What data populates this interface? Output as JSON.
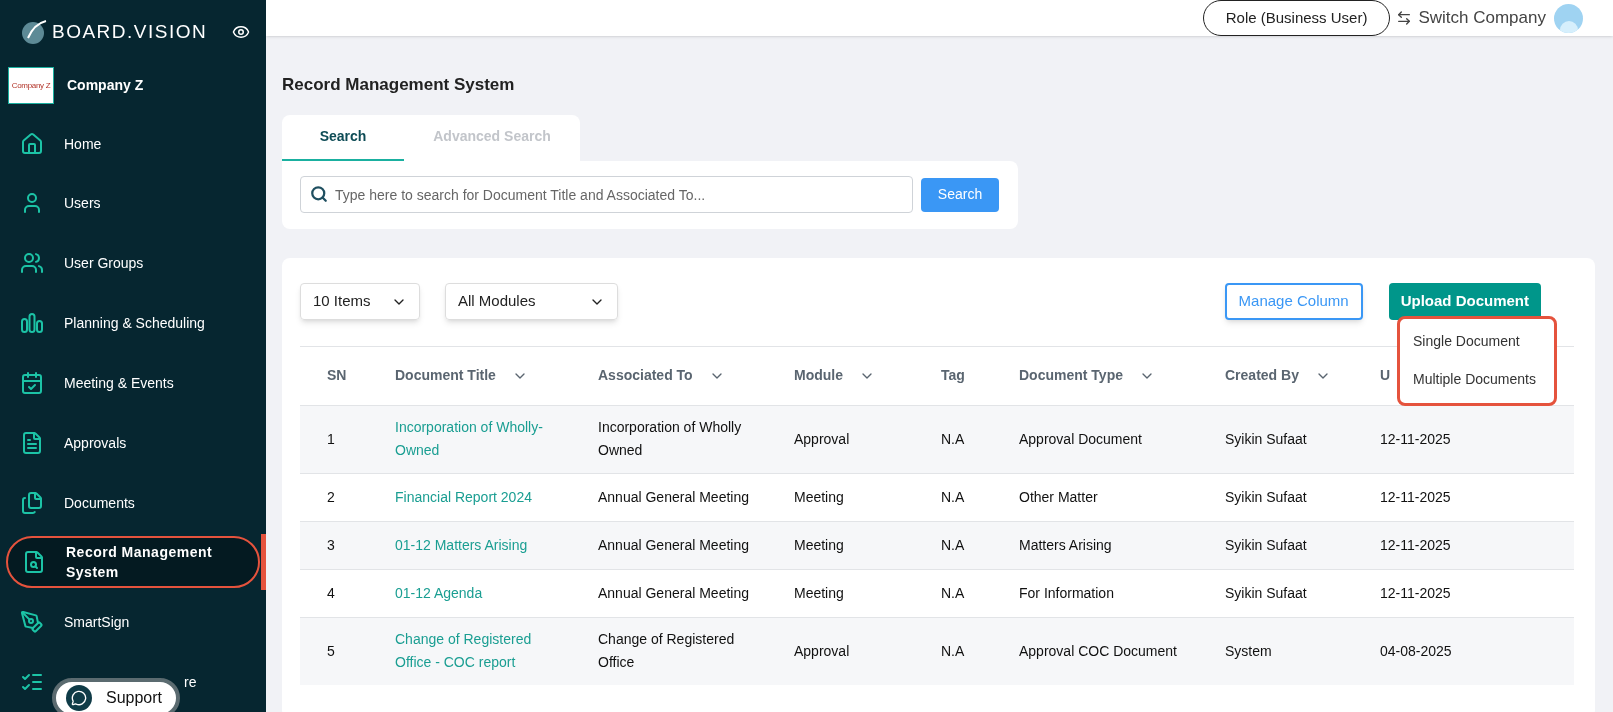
{
  "brand": {
    "name": "BOARD.VISION"
  },
  "company": {
    "logo_text": "Company Z",
    "name": "Company Z"
  },
  "sidebar": {
    "items": [
      {
        "label": "Home",
        "selected": false
      },
      {
        "label": "Users",
        "selected": false
      },
      {
        "label": "User Groups",
        "selected": false
      },
      {
        "label": "Planning & Scheduling",
        "selected": false
      },
      {
        "label": "Meeting & Events",
        "selected": false
      },
      {
        "label": "Approvals",
        "selected": false
      },
      {
        "label": "Documents",
        "selected": false
      },
      {
        "label": "Record Management System",
        "selected": true
      },
      {
        "label": "SmartSign",
        "selected": false
      },
      {
        "label": "re",
        "selected": false
      }
    ]
  },
  "support": {
    "label": "Support"
  },
  "topbar": {
    "role": "Role (Business User)",
    "switch": "Switch Company"
  },
  "page": {
    "title": "Record Management System"
  },
  "tabs": [
    {
      "label": "Search",
      "selected": true
    },
    {
      "label": "Advanced Search",
      "selected": false
    }
  ],
  "search": {
    "placeholder": "Type here to search for Document Title and Associated To...",
    "button": "Search"
  },
  "filters": [
    {
      "value": "10 Items"
    },
    {
      "value": "All Modules"
    }
  ],
  "actions": {
    "manage": "Manage Column",
    "upload": "Upload Document"
  },
  "upload_menu": [
    "Single Document",
    "Multiple Documents"
  ],
  "table": {
    "columns": [
      {
        "label": "SN",
        "sortable": false
      },
      {
        "label": "Document Title",
        "sortable": true
      },
      {
        "label": "Associated To",
        "sortable": true
      },
      {
        "label": "Module",
        "sortable": true
      },
      {
        "label": "Tag",
        "sortable": false
      },
      {
        "label": "Document Type",
        "sortable": true
      },
      {
        "label": "Created By",
        "sortable": true
      },
      {
        "label": "U",
        "sortable": false
      }
    ],
    "rows": [
      [
        "1",
        "Incorporation of Wholly-Owned",
        "Incorporation of Wholly Owned",
        "Approval",
        "N.A",
        "Approval Document",
        "Syikin Sufaat",
        "12-11-2025"
      ],
      [
        "2",
        "Financial Report 2024",
        "Annual General Meeting",
        "Meeting",
        "N.A",
        "Other Matter",
        "Syikin Sufaat",
        "12-11-2025"
      ],
      [
        "3",
        "01-12 Matters Arising",
        "Annual General Meeting",
        "Meeting",
        "N.A",
        "Matters Arising",
        "Syikin Sufaat",
        "12-11-2025"
      ],
      [
        "4",
        "01-12 Agenda",
        "Annual General Meeting",
        "Meeting",
        "N.A",
        "For Information",
        "Syikin Sufaat",
        "12-11-2025"
      ],
      [
        "5",
        "Change of Registered Office - COC report",
        "Change of Registered Office",
        "Approval",
        "N.A",
        "Approval COC Document",
        "System",
        "04-08-2025"
      ]
    ]
  }
}
